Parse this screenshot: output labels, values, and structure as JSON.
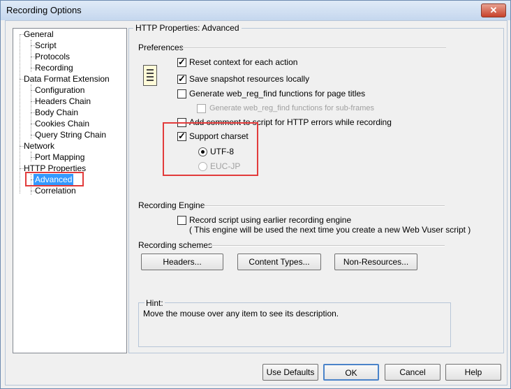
{
  "window": {
    "title": "Recording Options",
    "close_glyph": "✕"
  },
  "tree": {
    "items": [
      {
        "label": "General"
      },
      {
        "label": "Script"
      },
      {
        "label": "Protocols"
      },
      {
        "label": "Recording"
      },
      {
        "label": "Data Format Extension"
      },
      {
        "label": "Configuration"
      },
      {
        "label": "Headers Chain"
      },
      {
        "label": "Body Chain"
      },
      {
        "label": "Cookies Chain"
      },
      {
        "label": "Query String Chain"
      },
      {
        "label": "Network"
      },
      {
        "label": "Port Mapping"
      },
      {
        "label": "HTTP Properties"
      },
      {
        "label": "Advanced"
      },
      {
        "label": "Correlation"
      }
    ],
    "selected": "Advanced"
  },
  "panel": {
    "title": "HTTP Properties: Advanced",
    "preferences": {
      "heading": "Preferences",
      "options": [
        {
          "label": "Reset context for each action",
          "checked": true
        },
        {
          "label": "Save snapshot resources locally",
          "checked": true
        },
        {
          "label": "Generate web_reg_find functions for page titles",
          "checked": false
        },
        {
          "label": "Generate web_reg_find functions for sub-frames",
          "checked": false,
          "disabled": true
        },
        {
          "label": "Add comment to script for HTTP errors while recording",
          "checked": false
        },
        {
          "label": "Support charset",
          "checked": true
        }
      ],
      "charset": [
        {
          "label": "UTF-8",
          "selected": true
        },
        {
          "label": "EUC-JP",
          "selected": false,
          "disabled": true
        }
      ]
    },
    "engine": {
      "heading": "Recording Engine",
      "option_label": "Record script using earlier recording engine",
      "note": "( This engine will be used the next time you create a new Web Vuser script )"
    },
    "schemes": {
      "heading": "Recording schemes",
      "buttons": {
        "headers": "Headers...",
        "content_types": "Content Types...",
        "non_resources": "Non-Resources..."
      }
    },
    "hint": {
      "label": "Hint:",
      "text": "Move the mouse over any item to see its description."
    }
  },
  "footer": {
    "use_defaults": "Use Defaults",
    "ok": "OK",
    "cancel": "Cancel",
    "help": "Help"
  },
  "colors": {
    "highlight": "#e23b3b",
    "selection": "#3399ff",
    "default_button_border": "#4a83c9"
  }
}
